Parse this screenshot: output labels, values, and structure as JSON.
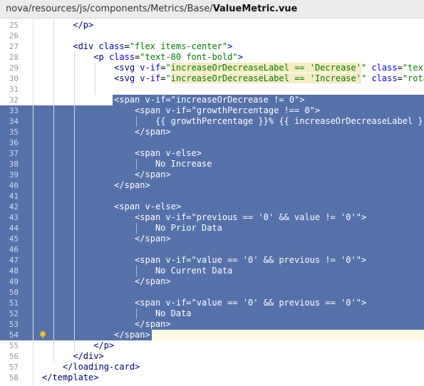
{
  "breadcrumb": {
    "path": "nova/resources/js/components/Metrics/Base/",
    "file": "ValueMetric.vue"
  },
  "icons": {
    "gutter": "lightbulb-icon"
  },
  "colors": {
    "selection": "#5572a8",
    "tag": "#000080",
    "attribute": "#0000ff",
    "string": "#008000",
    "caret_line": "#fffae3"
  },
  "editor": {
    "first_line": 25,
    "lines": [
      {
        "num": "25",
        "text": "      </p>"
      },
      {
        "num": "26",
        "text": ""
      },
      {
        "num": "27",
        "text": "      <div class=\"flex items-center\">"
      },
      {
        "num": "28",
        "text": "          <p class=\"text-80 font-bold\">"
      },
      {
        "num": "29",
        "text": "              <svg v-if=\"increaseOrDecreaseLabel == 'Decrease'\" class=\"text-dan"
      },
      {
        "num": "30",
        "text": "              <svg v-if=\"increaseOrDecreaseLabel == 'Increase'\" class=\"rotate"
      },
      {
        "num": "31",
        "text": ""
      },
      {
        "num": "32",
        "text": "              <span v-if=\"increaseOrDecrease != 0\">"
      },
      {
        "num": "33",
        "text": "                  <span v-if=\"growthPercentage !== 0\">"
      },
      {
        "num": "34",
        "text": "                      {{ growthPercentage }}% {{ increaseOrDecreaseLabel }}"
      },
      {
        "num": "35",
        "text": "                  </span>"
      },
      {
        "num": "36",
        "text": ""
      },
      {
        "num": "37",
        "text": "                  <span v-else>"
      },
      {
        "num": "38",
        "text": "                      No Increase"
      },
      {
        "num": "39",
        "text": "                  </span>"
      },
      {
        "num": "40",
        "text": "              </span>"
      },
      {
        "num": "41",
        "text": ""
      },
      {
        "num": "42",
        "text": "              <span v-else>"
      },
      {
        "num": "43",
        "text": "                  <span v-if=\"previous == '0' && value != '0'\">"
      },
      {
        "num": "44",
        "text": "                      No Prior Data"
      },
      {
        "num": "45",
        "text": "                  </span>"
      },
      {
        "num": "46",
        "text": ""
      },
      {
        "num": "47",
        "text": "                  <span v-if=\"value == '0' && previous != '0'\">"
      },
      {
        "num": "48",
        "text": "                      No Current Data"
      },
      {
        "num": "49",
        "text": "                  </span>"
      },
      {
        "num": "50",
        "text": ""
      },
      {
        "num": "51",
        "text": "                  <span v-if=\"value == '0' && previous == '0'\">"
      },
      {
        "num": "52",
        "text": "                      No Data"
      },
      {
        "num": "53",
        "text": "                  </span>"
      },
      {
        "num": "54",
        "text": "              </span>"
      },
      {
        "num": "55",
        "text": "          </p>"
      },
      {
        "num": "56",
        "text": "      </div>"
      },
      {
        "num": "57",
        "text": "    </loading-card>"
      },
      {
        "num": "58",
        "text": "</template>"
      }
    ]
  }
}
